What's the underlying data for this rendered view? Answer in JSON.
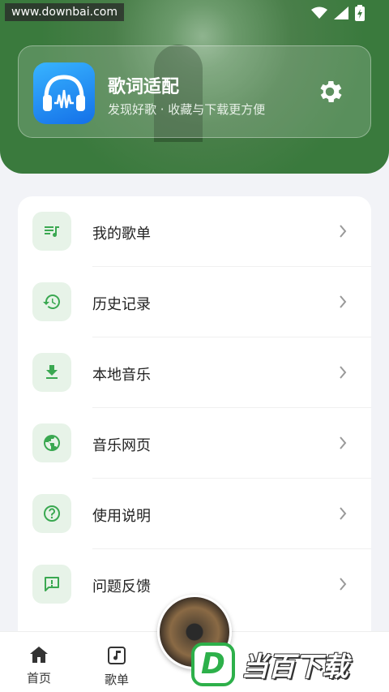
{
  "watermark_top": "www.downbai.com",
  "header": {
    "app_name": "歌词适配",
    "tagline": "发现好歌 · 收藏与下载更方便",
    "logo_icon": "headphones-logo-icon",
    "settings_icon": "gear-icon"
  },
  "menu": {
    "items": [
      {
        "label": "我的歌单",
        "icon": "playlist-icon"
      },
      {
        "label": "历史记录",
        "icon": "history-icon"
      },
      {
        "label": "本地音乐",
        "icon": "download-icon"
      },
      {
        "label": "音乐网页",
        "icon": "globe-icon"
      },
      {
        "label": "使用说明",
        "icon": "help-icon"
      },
      {
        "label": "问题反馈",
        "icon": "feedback-icon"
      }
    ]
  },
  "bottom_nav": {
    "items": [
      {
        "label": "首页",
        "icon": "home-icon"
      },
      {
        "label": "歌单",
        "icon": "music-note-icon"
      }
    ]
  },
  "brand_watermark": {
    "letter": "D",
    "text": "当百下载"
  },
  "colors": {
    "accent": "#3a7a3d",
    "icon_green": "#3aa851",
    "icon_bg": "#e7f3e8"
  }
}
